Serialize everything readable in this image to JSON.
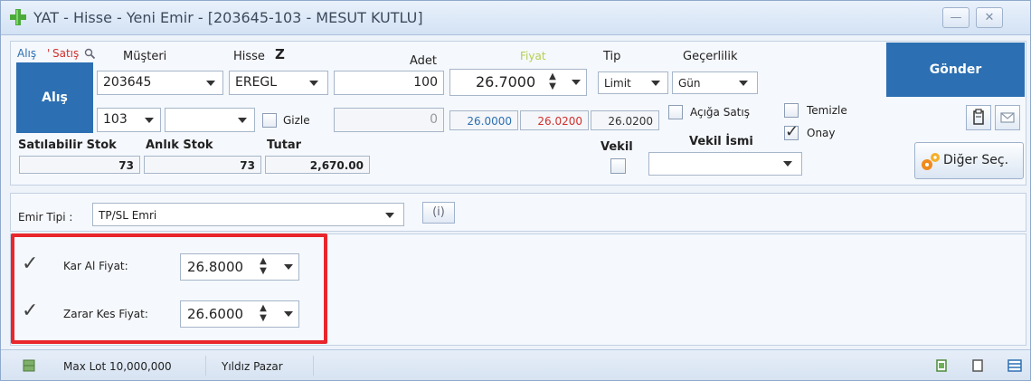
{
  "window": {
    "title": "YAT - Hisse - Yeni Emir - [203645-103 - MESUT KUTLU]",
    "minimize_label": "—",
    "close_label": "✕"
  },
  "order": {
    "side_buy": "Alış",
    "side_sep": "'",
    "side_sell": "Satış",
    "buy_button": "Alış",
    "send_button": "Gönder",
    "other_button": "Diğer Seç."
  },
  "headers": {
    "customer": "Müşteri",
    "stock": "Hisse",
    "stock_z": "Z",
    "quantity": "Adet",
    "price": "Fiyat",
    "type": "Tip",
    "validity": "Geçerlilik"
  },
  "fields": {
    "customer_no": "203645",
    "account_no": "103",
    "account_extra": "",
    "stock": "EREGL",
    "quantity": "100",
    "quantity_secondary": "0",
    "price": "26.7000",
    "type": "Limit",
    "validity": "Gün",
    "price_low": "26.0000",
    "price_high": "26.0200",
    "price_last": "26.0200",
    "hide_label": "Gizle",
    "short_sell_label": "Açığa Satış",
    "clear_label": "Temizle",
    "confirm_label": "Onay"
  },
  "stock_info": {
    "sellable_label": "Satılabilir Stok",
    "instant_label": "Anlık Stok",
    "total_label": "Tutar",
    "sellable_value": "73",
    "instant_value": "73",
    "total_value": "2,670.00",
    "proxy_label": "Vekil",
    "proxy_name_label": "Vekil İsmi",
    "proxy_name_value": ""
  },
  "order_type": {
    "label": "Emir Tipi :",
    "value": "TP/SL Emri",
    "info_label": "(i)"
  },
  "tpsl": {
    "take_profit_label": "Kar Al Fiyat:",
    "take_profit_value": "26.8000",
    "stop_loss_label": "Zarar Kes Fiyat:",
    "stop_loss_value": "26.6000"
  },
  "status": {
    "max_lot": "Max Lot 10,000,000",
    "market": "Yıldız Pazar"
  },
  "colors": {
    "accent_blue": "#2c6fb2",
    "buy_red": "#d0312d",
    "price_green": "#9cba3a",
    "highlight_red": "#e8262c"
  }
}
